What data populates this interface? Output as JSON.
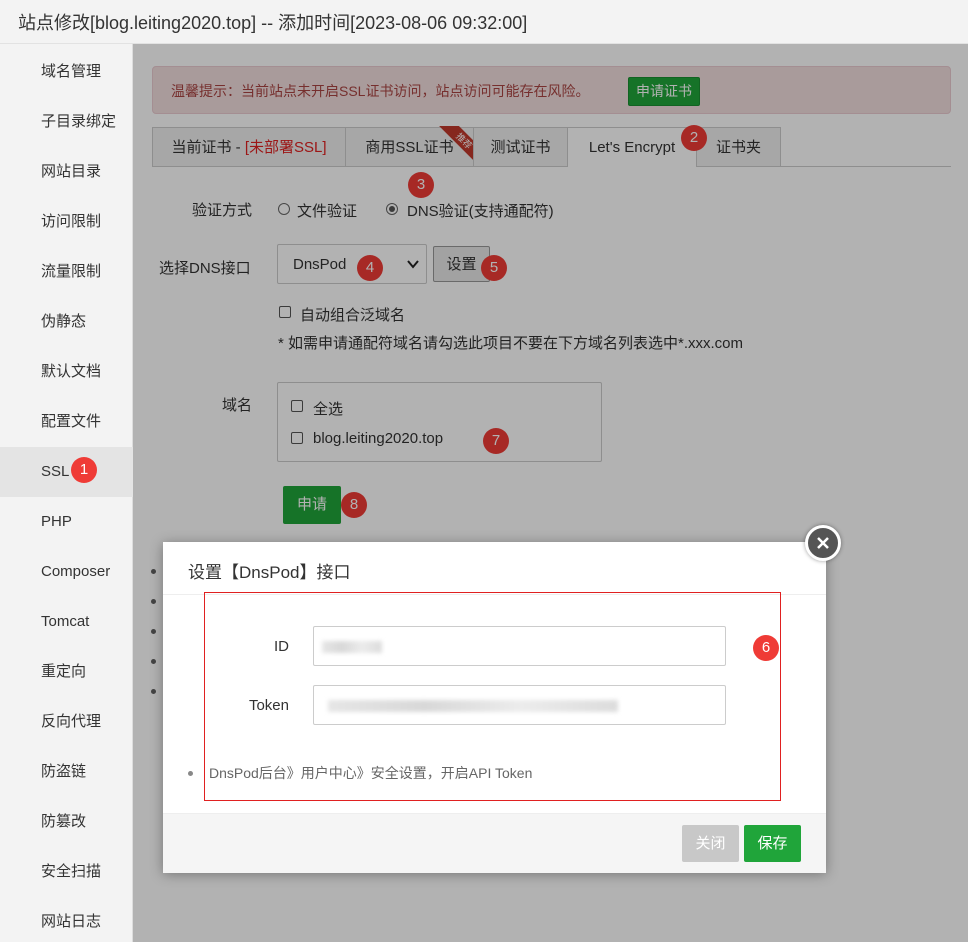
{
  "window": {
    "title": "站点修改[blog.leiting2020.top] -- 添加时间[2023-08-06 09:32:00]"
  },
  "sidebar": {
    "items": [
      {
        "label": "域名管理"
      },
      {
        "label": "子目录绑定"
      },
      {
        "label": "网站目录"
      },
      {
        "label": "访问限制"
      },
      {
        "label": "流量限制"
      },
      {
        "label": "伪静态"
      },
      {
        "label": "默认文档"
      },
      {
        "label": "配置文件"
      },
      {
        "label": "SSL"
      },
      {
        "label": "PHP"
      },
      {
        "label": "Composer"
      },
      {
        "label": "Tomcat"
      },
      {
        "label": "重定向"
      },
      {
        "label": "反向代理"
      },
      {
        "label": "防盗链"
      },
      {
        "label": "防篡改"
      },
      {
        "label": "安全扫描"
      },
      {
        "label": "网站日志"
      }
    ],
    "active": "SSL"
  },
  "alert": {
    "text": "温馨提示：当前站点未开启SSL证书访问，站点访问可能存在风险。",
    "button": "申请证书"
  },
  "tabs": [
    {
      "label": "当前证书 - ",
      "extra": "[未部署SSL]"
    },
    {
      "label": "商用SSL证书",
      "ribbon": "推荐"
    },
    {
      "label": "测试证书"
    },
    {
      "label": "Let's Encrypt"
    },
    {
      "label": "证书夹"
    }
  ],
  "form": {
    "verify_label": "验证方式",
    "verify_options": [
      "文件验证",
      "DNS验证(支持通配符)"
    ],
    "verify_selected": "DNS验证(支持通配符)",
    "dns_label": "选择DNS接口",
    "dns_value": "DnsPod",
    "settings_button": "设置",
    "wildcard_checkbox": "自动组合泛域名",
    "wildcard_note": "* 如需申请通配符域名请勾选此项目不要在下方域名列表选中*.xxx.com",
    "domain_label": "域名",
    "domain_select_all": "全选",
    "domains": [
      "blog.leiting2020.top"
    ],
    "apply_button": "申请"
  },
  "badges": [
    "1",
    "2",
    "3",
    "4",
    "5",
    "6",
    "7",
    "8"
  ],
  "modal": {
    "title": "设置【DnsPod】接口",
    "id_label": "ID",
    "token_label": "Token",
    "help_text": "DnsPod后台》用户中心》安全设置，开启API Token",
    "close_button": "关闭",
    "save_button": "保存"
  },
  "colors": {
    "accent_green": "#20a53a",
    "badge_red": "#ef3b36",
    "alert_text": "#a94442"
  }
}
